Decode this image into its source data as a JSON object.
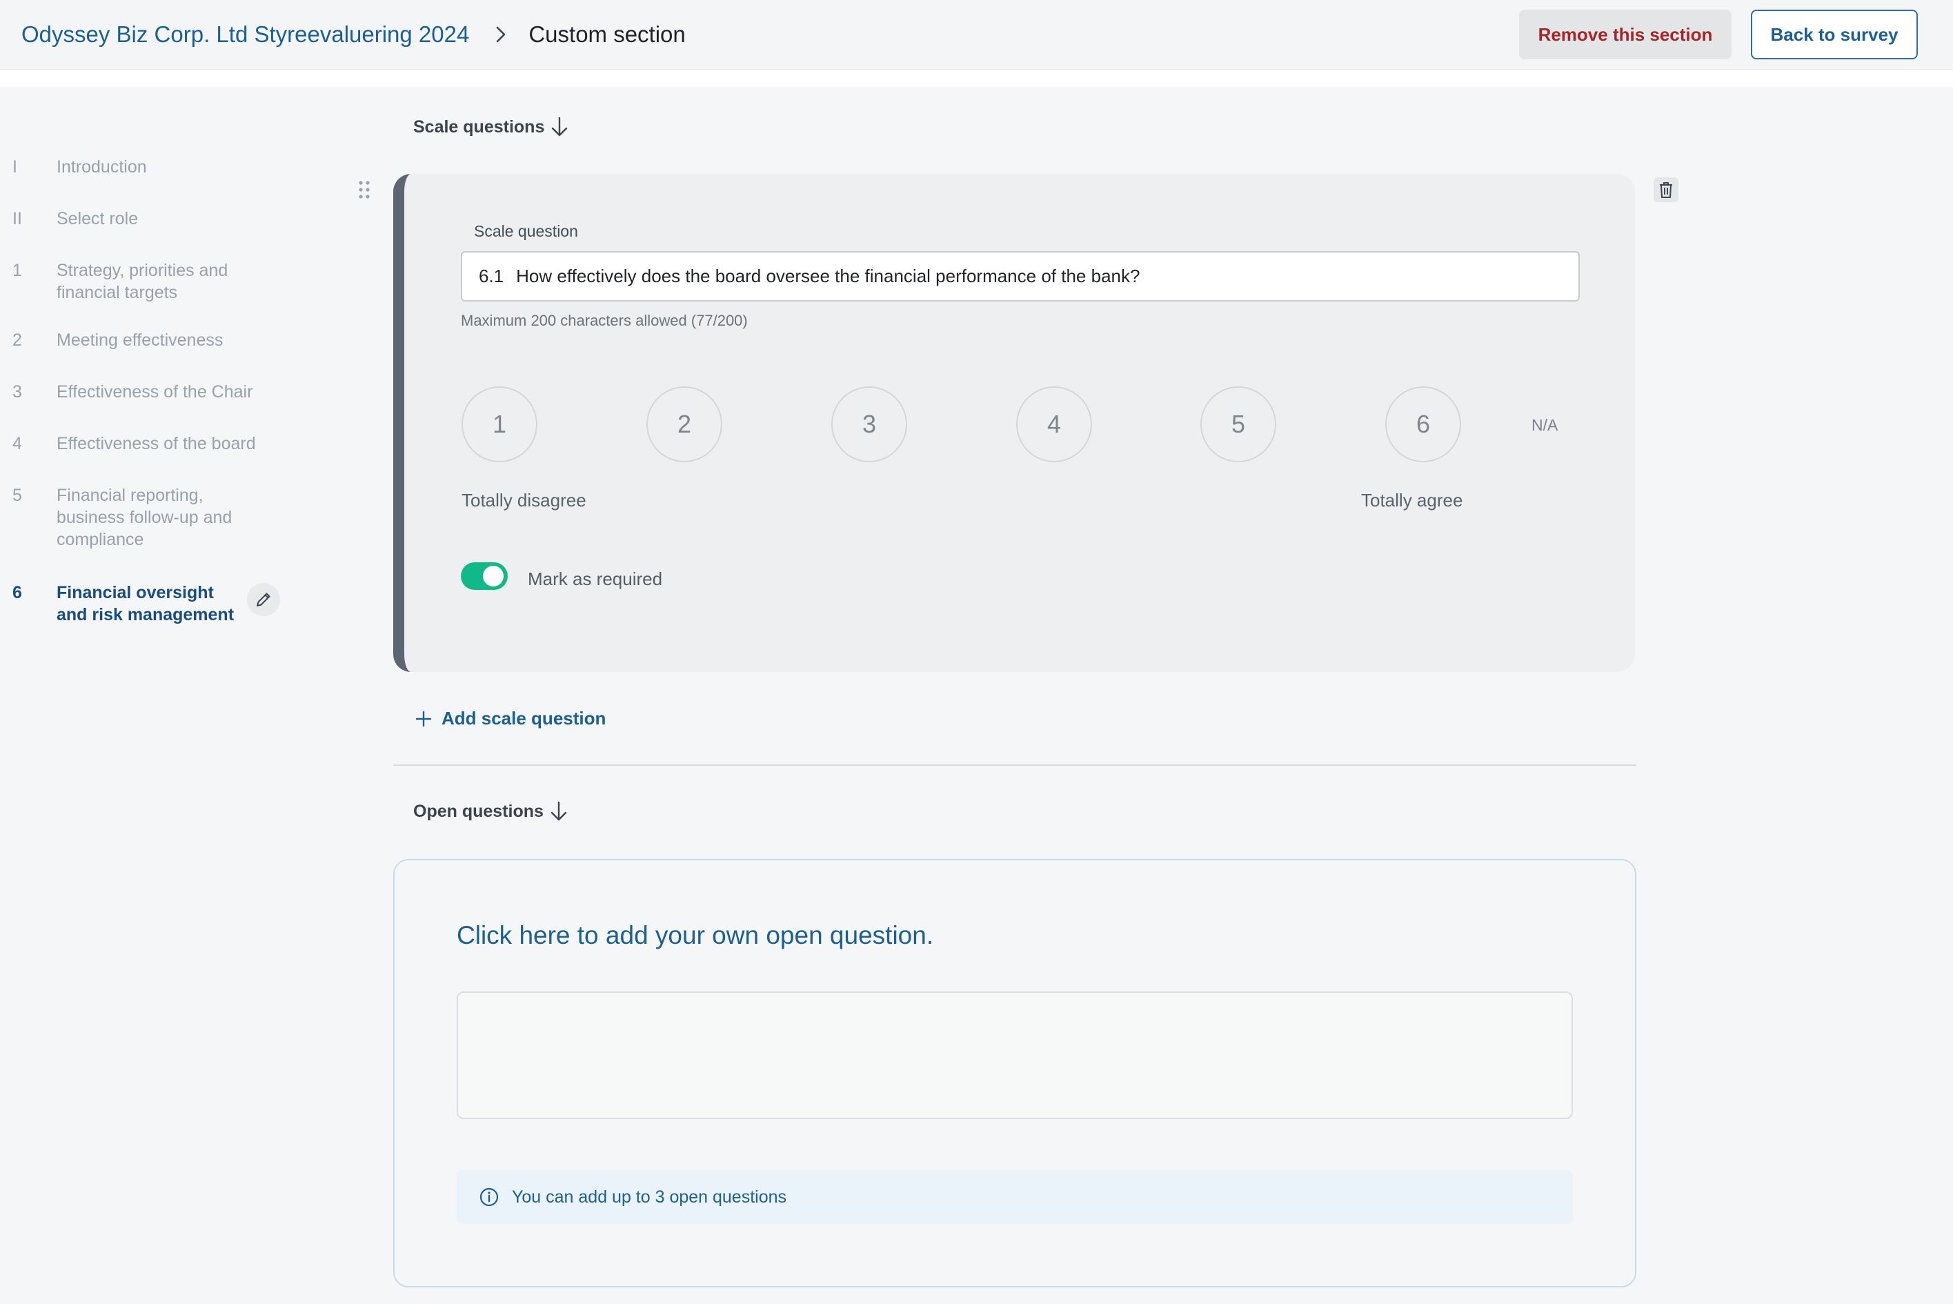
{
  "header": {
    "survey_title": "Odyssey Biz Corp. Ltd Styreevaluering 2024",
    "current_page": "Custom section",
    "remove_label": "Remove this section",
    "back_label": "Back to survey"
  },
  "sidebar": {
    "items": [
      {
        "num": "I",
        "label": "Introduction"
      },
      {
        "num": "II",
        "label": "Select role"
      },
      {
        "num": "1",
        "label": "Strategy, priorities and financial targets"
      },
      {
        "num": "2",
        "label": "Meeting effectiveness"
      },
      {
        "num": "3",
        "label": "Effectiveness of the Chair"
      },
      {
        "num": "4",
        "label": "Effectiveness of the board"
      },
      {
        "num": "5",
        "label": "Financial reporting, business follow-up and compliance"
      },
      {
        "num": "6",
        "label": "Financial oversight and risk management"
      }
    ]
  },
  "scale_section": {
    "heading": "Scale questions",
    "field_label": "Scale question",
    "question_number": "6.1",
    "question_text": "How effectively does the board oversee the financial performance of the bank?",
    "char_hint": "Maximum 200 characters allowed (77/200)",
    "scale_values": [
      "1",
      "2",
      "3",
      "4",
      "5",
      "6"
    ],
    "na_label": "N/A",
    "low_label": "Totally disagree",
    "high_label": "Totally agree",
    "required_label": "Mark as required",
    "required_on": true,
    "add_label": "Add scale question"
  },
  "open_section": {
    "heading": "Open questions",
    "prompt": "Click here to add your own open question.",
    "info": "You can add up to 3 open questions"
  },
  "colors": {
    "accent": "#1d5f8f",
    "danger": "#a3272a",
    "toggle_on": "#11b98a"
  }
}
